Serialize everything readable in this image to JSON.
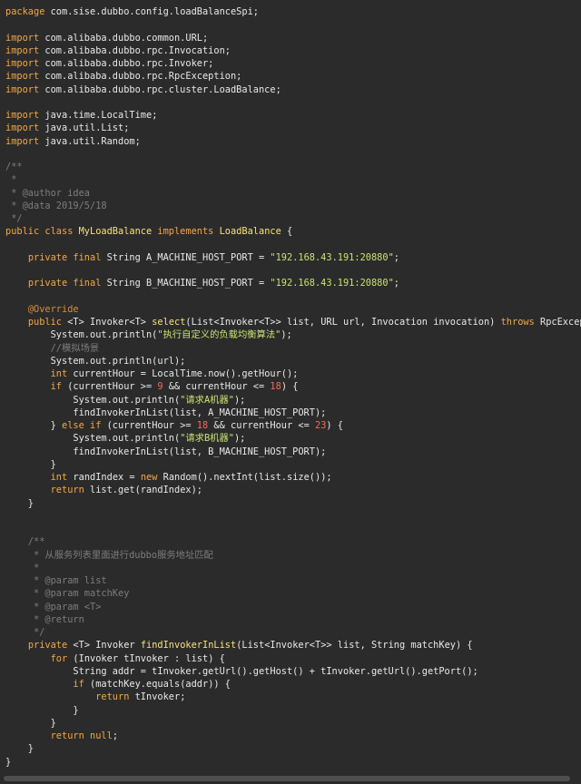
{
  "editor": {
    "lines": [
      [
        [
          "kw",
          "package"
        ],
        [
          "pl",
          " com.sise.dubbo.config.loadBalanceSpi;"
        ]
      ],
      [],
      [
        [
          "kw",
          "import"
        ],
        [
          "pl",
          " com.alibaba.dubbo.common.URL;"
        ]
      ],
      [
        [
          "kw",
          "import"
        ],
        [
          "pl",
          " com.alibaba.dubbo.rpc.Invocation;"
        ]
      ],
      [
        [
          "kw",
          "import"
        ],
        [
          "pl",
          " com.alibaba.dubbo.rpc.Invoker;"
        ]
      ],
      [
        [
          "kw",
          "import"
        ],
        [
          "pl",
          " com.alibaba.dubbo.rpc.RpcException;"
        ]
      ],
      [
        [
          "kw",
          "import"
        ],
        [
          "pl",
          " com.alibaba.dubbo.rpc.cluster.LoadBalance;"
        ]
      ],
      [],
      [
        [
          "kw",
          "import"
        ],
        [
          "pl",
          " java.time.LocalTime;"
        ]
      ],
      [
        [
          "kw",
          "import"
        ],
        [
          "pl",
          " java.util.List;"
        ]
      ],
      [
        [
          "kw",
          "import"
        ],
        [
          "pl",
          " java.util.Random;"
        ]
      ],
      [],
      [
        [
          "cm",
          "/**"
        ]
      ],
      [
        [
          "cm",
          " *"
        ]
      ],
      [
        [
          "cm",
          " * @author idea"
        ]
      ],
      [
        [
          "cm",
          " * @data 2019/5/18"
        ]
      ],
      [
        [
          "cm",
          " */"
        ]
      ],
      [
        [
          "kw",
          "public class "
        ],
        [
          "ty",
          "MyLoadBalance"
        ],
        [
          "kw",
          " implements "
        ],
        [
          "ty",
          "LoadBalance"
        ],
        [
          "pl",
          " {"
        ]
      ],
      [],
      [
        [
          "pl",
          "    "
        ],
        [
          "kw",
          "private final"
        ],
        [
          "pl",
          " String A_MACHINE_HOST_PORT = "
        ],
        [
          "str",
          "\"192.168.43.191:20880\""
        ],
        [
          "pl",
          ";"
        ]
      ],
      [],
      [
        [
          "pl",
          "    "
        ],
        [
          "kw",
          "private final"
        ],
        [
          "pl",
          " String B_MACHINE_HOST_PORT = "
        ],
        [
          "str",
          "\"192.168.43.191:20880\""
        ],
        [
          "pl",
          ";"
        ]
      ],
      [],
      [
        [
          "pl",
          "    "
        ],
        [
          "ann",
          "@Override"
        ]
      ],
      [
        [
          "pl",
          "    "
        ],
        [
          "kw",
          "public"
        ],
        [
          "pl",
          " <T> Invoker<T> "
        ],
        [
          "fn",
          "select"
        ],
        [
          "pl",
          "(List<Invoker<T>> list, URL url, Invocation invocation) "
        ],
        [
          "kw",
          "throws"
        ],
        [
          "pl",
          " RpcException {"
        ]
      ],
      [
        [
          "pl",
          "        System.out.println("
        ],
        [
          "str",
          "\"执行自定义的负载均衡算法\""
        ],
        [
          "pl",
          ");"
        ]
      ],
      [
        [
          "pl",
          "        "
        ],
        [
          "cm",
          "//模拟场景"
        ]
      ],
      [
        [
          "pl",
          "        System.out.println(url);"
        ]
      ],
      [
        [
          "pl",
          "        "
        ],
        [
          "kw",
          "int"
        ],
        [
          "pl",
          " currentHour = LocalTime.now().getHour();"
        ]
      ],
      [
        [
          "pl",
          "        "
        ],
        [
          "kw",
          "if"
        ],
        [
          "pl",
          " (currentHour >= "
        ],
        [
          "num",
          "9"
        ],
        [
          "pl",
          " && currentHour <= "
        ],
        [
          "num",
          "18"
        ],
        [
          "pl",
          ") {"
        ]
      ],
      [
        [
          "pl",
          "            System.out.println("
        ],
        [
          "str",
          "\"请求A机器\""
        ],
        [
          "pl",
          ");"
        ]
      ],
      [
        [
          "pl",
          "            findInvokerInList(list, A_MACHINE_HOST_PORT);"
        ]
      ],
      [
        [
          "pl",
          "        } "
        ],
        [
          "kw",
          "else if"
        ],
        [
          "pl",
          " (currentHour >= "
        ],
        [
          "num",
          "18"
        ],
        [
          "pl",
          " && currentHour <= "
        ],
        [
          "num",
          "23"
        ],
        [
          "pl",
          ") {"
        ]
      ],
      [
        [
          "pl",
          "            System.out.println("
        ],
        [
          "str",
          "\"请求B机器\""
        ],
        [
          "pl",
          ");"
        ]
      ],
      [
        [
          "pl",
          "            findInvokerInList(list, B_MACHINE_HOST_PORT);"
        ]
      ],
      [
        [
          "pl",
          "        }"
        ]
      ],
      [
        [
          "pl",
          "        "
        ],
        [
          "kw",
          "int"
        ],
        [
          "pl",
          " randIndex = "
        ],
        [
          "kw",
          "new"
        ],
        [
          "pl",
          " Random().nextInt(list.size());"
        ]
      ],
      [
        [
          "pl",
          "        "
        ],
        [
          "kw",
          "return"
        ],
        [
          "pl",
          " list.get(randIndex);"
        ]
      ],
      [
        [
          "pl",
          "    }"
        ]
      ],
      [],
      [],
      [
        [
          "pl",
          "    "
        ],
        [
          "cm",
          "/**"
        ]
      ],
      [
        [
          "pl",
          "    "
        ],
        [
          "cm",
          " * 从服务列表里面进行dubbo服务地址匹配"
        ]
      ],
      [
        [
          "pl",
          "    "
        ],
        [
          "cm",
          " *"
        ]
      ],
      [
        [
          "pl",
          "    "
        ],
        [
          "cm",
          " * @param list"
        ]
      ],
      [
        [
          "pl",
          "    "
        ],
        [
          "cm",
          " * @param matchKey"
        ]
      ],
      [
        [
          "pl",
          "    "
        ],
        [
          "cm",
          " * @param <T>"
        ]
      ],
      [
        [
          "pl",
          "    "
        ],
        [
          "cm",
          " * @return"
        ]
      ],
      [
        [
          "pl",
          "    "
        ],
        [
          "cm",
          " */"
        ]
      ],
      [
        [
          "pl",
          "    "
        ],
        [
          "kw",
          "private"
        ],
        [
          "pl",
          " <T> Invoker "
        ],
        [
          "fn",
          "findInvokerInList"
        ],
        [
          "pl",
          "(List<Invoker<T>> list, String matchKey) {"
        ]
      ],
      [
        [
          "pl",
          "        "
        ],
        [
          "kw",
          "for"
        ],
        [
          "pl",
          " (Invoker tInvoker : list) {"
        ]
      ],
      [
        [
          "pl",
          "            String addr = tInvoker.getUrl().getHost() + tInvoker.getUrl().getPort();"
        ]
      ],
      [
        [
          "pl",
          "            "
        ],
        [
          "kw",
          "if"
        ],
        [
          "pl",
          " (matchKey.equals(addr)) {"
        ]
      ],
      [
        [
          "pl",
          "                "
        ],
        [
          "kw",
          "return"
        ],
        [
          "pl",
          " tInvoker;"
        ]
      ],
      [
        [
          "pl",
          "            }"
        ]
      ],
      [
        [
          "pl",
          "        }"
        ]
      ],
      [
        [
          "pl",
          "        "
        ],
        [
          "kw",
          "return null"
        ],
        [
          "pl",
          ";"
        ]
      ],
      [
        [
          "pl",
          "    }"
        ]
      ],
      [
        [
          "pl",
          "}"
        ]
      ]
    ]
  },
  "scrollbar": {
    "thumb_color": "#4e4e4e"
  },
  "colors": {
    "background": "#2b2b2b",
    "keyword": "#f1a848",
    "string": "#c8e373",
    "comment": "#7d7d7d",
    "annotation": "#d98b3a",
    "number": "#f26b5c",
    "method": "#f7e27a",
    "text": "#e8e8e8"
  }
}
